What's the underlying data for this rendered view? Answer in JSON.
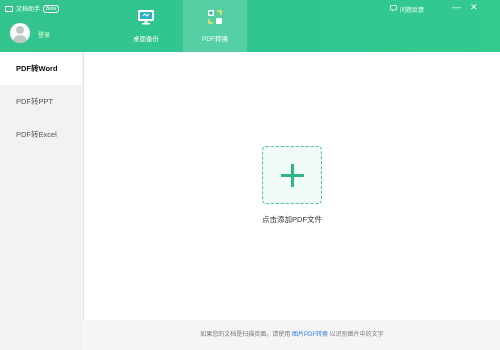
{
  "app": {
    "title": "文档助手",
    "badge": "Beta",
    "login_label": "登录"
  },
  "tabs": [
    {
      "label": "桌面备份",
      "icon": "monitor-icon"
    },
    {
      "label": "PDF转换",
      "icon": "convert-icon"
    }
  ],
  "feedback_label": "问题反馈",
  "window": {
    "minimize": "—",
    "close": "✕"
  },
  "sidebar": {
    "items": [
      {
        "label": "PDF转Word",
        "active": true
      },
      {
        "label": "PDF转PPT",
        "active": false
      },
      {
        "label": "PDF转Excel",
        "active": false
      }
    ]
  },
  "main": {
    "add_label": "点击添加PDF文件",
    "add_icon": "plus-icon"
  },
  "footer": {
    "text_before": "如果您的文档是扫描页面，请使用",
    "link": "图片PDF转换",
    "text_after": "以识别图片中的文字"
  },
  "colors": {
    "header": "#33c48e",
    "accent": "#2db784",
    "link": "#2f7ee0"
  }
}
